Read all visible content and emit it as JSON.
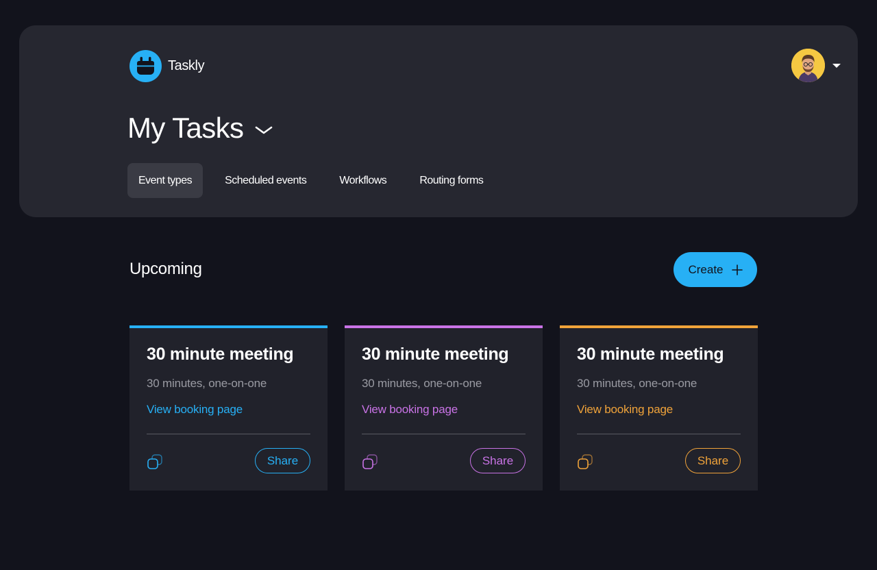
{
  "app": {
    "name": "Taskly",
    "brand_color": "#27b0f5"
  },
  "header": {
    "page_title": "My Tasks",
    "tabs": [
      {
        "label": "Event types",
        "active": true
      },
      {
        "label": "Scheduled events",
        "active": false
      },
      {
        "label": "Workflows",
        "active": false
      },
      {
        "label": "Routing forms",
        "active": false
      }
    ]
  },
  "main": {
    "section_title": "Upcoming",
    "create_label": "Create",
    "cards": [
      {
        "title": "30 minute meeting",
        "subtitle": "30 minutes, one-on-one",
        "link_label": "View booking page",
        "share_label": "Share",
        "accent": "#27b0f5"
      },
      {
        "title": "30 minute meeting",
        "subtitle": "30 minutes, one-on-one",
        "link_label": "View booking page",
        "share_label": "Share",
        "accent": "#c973e6"
      },
      {
        "title": "30 minute meeting",
        "subtitle": "30 minutes, one-on-one",
        "link_label": "View booking page",
        "share_label": "Share",
        "accent": "#f0a33a"
      }
    ]
  },
  "icons": {
    "logo": "calendar-logo-icon",
    "avatar_caret": "caret-down-icon",
    "title_chevron": "chevron-down-icon",
    "create": "plus-icon",
    "copy": "copy-icon"
  }
}
